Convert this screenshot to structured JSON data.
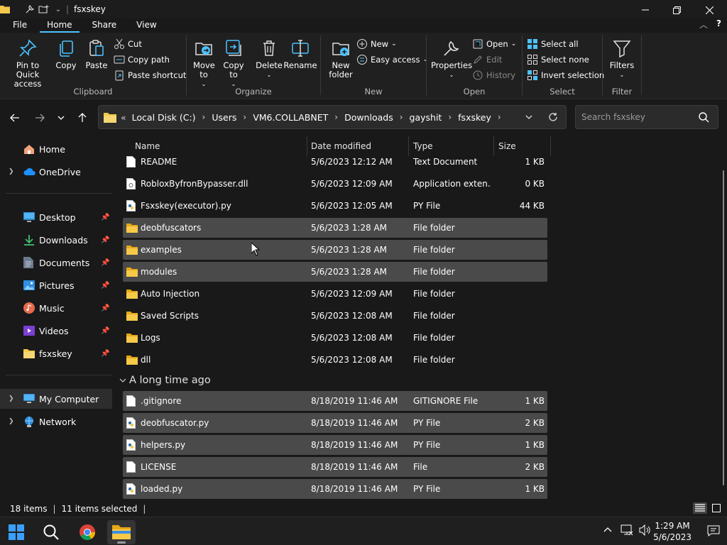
{
  "window": {
    "title": "fsxskey"
  },
  "menu_tabs": [
    "File",
    "Home",
    "Share",
    "View"
  ],
  "ribbon": {
    "clipboard": {
      "label": "Clipboard",
      "pin": "Pin to Quick access",
      "copy": "Copy",
      "paste": "Paste",
      "cut": "Cut",
      "copy_path": "Copy path",
      "paste_shortcut": "Paste shortcut"
    },
    "organize": {
      "label": "Organize",
      "move_to": "Move to",
      "copy_to": "Copy to",
      "delete": "Delete",
      "rename": "Rename"
    },
    "new": {
      "label": "New",
      "new_folder": "New folder",
      "new_item": "New",
      "easy_access": "Easy access"
    },
    "open": {
      "label": "Open",
      "properties": "Properties",
      "open": "Open",
      "edit": "Edit",
      "history": "History"
    },
    "select": {
      "label": "Select",
      "select_all": "Select all",
      "select_none": "Select none",
      "invert": "Invert selection"
    },
    "filter": {
      "label": "Filter",
      "filters": "Filters"
    }
  },
  "address": {
    "overflow": "«",
    "crumbs": [
      "Local Disk (C:)",
      "Users",
      "VM6.COLLABNET",
      "Downloads",
      "gayshit",
      "fsxskey"
    ],
    "search_placeholder": "Search fsxskey"
  },
  "nav": {
    "home": "Home",
    "onedrive": "OneDrive",
    "pinned": [
      "Desktop",
      "Downloads",
      "Documents",
      "Pictures",
      "Music",
      "Videos",
      "fsxskey"
    ],
    "my_computer": "My Computer",
    "network": "Network"
  },
  "columns": {
    "name": "Name",
    "date": "Date modified",
    "type": "Type",
    "size": "Size"
  },
  "files_recent": [
    {
      "name": "README",
      "date": "5/6/2023 12:12 AM",
      "type": "Text Document",
      "size": "1 KB",
      "icon": "text-file-icon",
      "selected": false
    },
    {
      "name": "RobloxByfronBypasser.dll",
      "date": "5/6/2023 12:09 AM",
      "type": "Application exten...",
      "size": "0 KB",
      "icon": "dll-file-icon",
      "selected": false
    },
    {
      "name": "Fsxskey(executor).py",
      "date": "5/6/2023 12:05 AM",
      "type": "PY File",
      "size": "44 KB",
      "icon": "python-file-icon",
      "selected": false
    },
    {
      "name": "deobfuscators",
      "date": "5/6/2023 1:28 AM",
      "type": "File folder",
      "size": "",
      "icon": "folder-icon",
      "selected": true
    },
    {
      "name": "examples",
      "date": "5/6/2023 1:28 AM",
      "type": "File folder",
      "size": "",
      "icon": "folder-icon",
      "selected": true
    },
    {
      "name": "modules",
      "date": "5/6/2023 1:28 AM",
      "type": "File folder",
      "size": "",
      "icon": "folder-icon",
      "selected": true
    },
    {
      "name": "Auto Injection",
      "date": "5/6/2023 12:09 AM",
      "type": "File folder",
      "size": "",
      "icon": "folder-icon",
      "selected": false
    },
    {
      "name": "Saved Scripts",
      "date": "5/6/2023 12:08 AM",
      "type": "File folder",
      "size": "",
      "icon": "folder-icon",
      "selected": false
    },
    {
      "name": "Logs",
      "date": "5/6/2023 12:08 AM",
      "type": "File folder",
      "size": "",
      "icon": "folder-icon",
      "selected": false
    },
    {
      "name": "dll",
      "date": "5/6/2023 12:08 AM",
      "type": "File folder",
      "size": "",
      "icon": "folder-icon",
      "selected": false
    }
  ],
  "group_header": "A long time ago",
  "files_old": [
    {
      "name": ".gitignore",
      "date": "8/18/2019 11:46 AM",
      "type": "GITIGNORE File",
      "size": "1 KB",
      "icon": "text-file-icon",
      "selected": true
    },
    {
      "name": "deobfuscator.py",
      "date": "8/18/2019 11:46 AM",
      "type": "PY File",
      "size": "2 KB",
      "icon": "python-file-icon",
      "selected": true
    },
    {
      "name": "helpers.py",
      "date": "8/18/2019 11:46 AM",
      "type": "PY File",
      "size": "1 KB",
      "icon": "python-file-icon",
      "selected": true
    },
    {
      "name": "LICENSE",
      "date": "8/18/2019 11:46 AM",
      "type": "File",
      "size": "2 KB",
      "icon": "text-file-icon",
      "selected": true
    },
    {
      "name": "loaded.py",
      "date": "8/18/2019 11:46 AM",
      "type": "PY File",
      "size": "1 KB",
      "icon": "python-file-icon",
      "selected": true
    }
  ],
  "status": {
    "items": "18 items",
    "selected": "11 items selected"
  },
  "clock": {
    "time": "1:29 AM",
    "date": "5/6/2023"
  },
  "colors": {
    "accent": "#4cc2ff",
    "folder": "#f2c94c",
    "selection": "#4a4a4a"
  }
}
